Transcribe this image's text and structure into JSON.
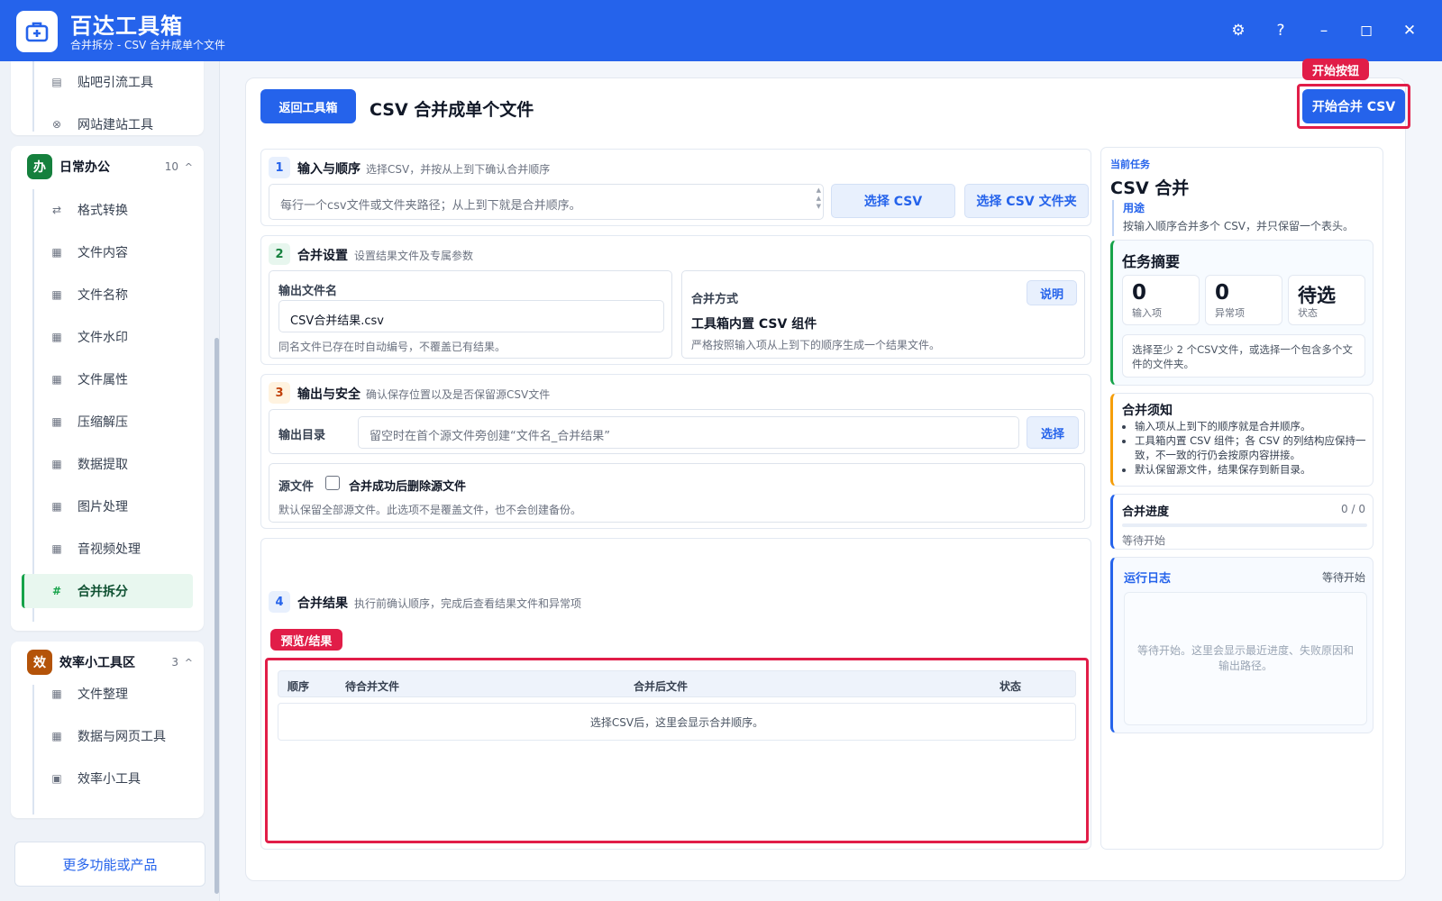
{
  "app": {
    "title": "百达工具箱",
    "subtitle": "合并拆分 - CSV 合并成单个文件"
  },
  "titlebar_icons": [
    "gear-icon",
    "help-icon",
    "minimize-icon",
    "maximize-icon",
    "close-icon"
  ],
  "sidebar": {
    "top_items": [
      {
        "label": "贴吧引流工具",
        "icon": "doc-icon"
      },
      {
        "label": "网站建站工具",
        "icon": "globe-icon"
      }
    ],
    "group_daily": {
      "badge": "办",
      "title": "日常办公",
      "count": "10",
      "color": "#15803d"
    },
    "daily_items": [
      {
        "label": "格式转换",
        "icon": "swap-icon"
      },
      {
        "label": "文件内容",
        "icon": "grid-icon"
      },
      {
        "label": "文件名称",
        "icon": "grid-icon"
      },
      {
        "label": "文件水印",
        "icon": "grid-icon"
      },
      {
        "label": "文件属性",
        "icon": "grid-icon"
      },
      {
        "label": "压缩解压",
        "icon": "grid-icon"
      },
      {
        "label": "数据提取",
        "icon": "grid-icon"
      },
      {
        "label": "图片处理",
        "icon": "grid-icon"
      },
      {
        "label": "音视频处理",
        "icon": "grid-icon"
      },
      {
        "label": "合并拆分",
        "icon": "hash-icon",
        "active": true
      }
    ],
    "group_eff": {
      "badge": "效",
      "title": "效率小工具区",
      "count": "3",
      "color": "#b45309"
    },
    "eff_items": [
      {
        "label": "文件整理",
        "icon": "grid-icon"
      },
      {
        "label": "数据与网页工具",
        "icon": "grid-icon"
      },
      {
        "label": "效率小工具",
        "icon": "box-icon"
      }
    ],
    "more_button": "更多功能或产品"
  },
  "header": {
    "back_button": "返回工具箱",
    "title": "CSV 合并成单个文件",
    "start_button": "开始合并 CSV",
    "start_tag": "开始按钮"
  },
  "section1": {
    "num": "1",
    "title": "输入与顺序",
    "desc": "选择CSV，并按从上到下确认合并顺序",
    "placeholder": "每行一个csv文件或文件夹路径；从上到下就是合并顺序。",
    "btn_select": "选择 CSV",
    "btn_select_folder": "选择 CSV 文件夹"
  },
  "section2": {
    "num": "2",
    "title": "合并设置",
    "desc": "设置结果文件及专属参数",
    "out_label": "输出文件名",
    "out_value": "CSV合并结果.csv",
    "out_hint": "同名文件已存在时自动编号，不覆盖已有结果。",
    "mode_label": "合并方式",
    "mode_help": "说明",
    "mode_value": "工具箱内置 CSV 组件",
    "mode_hint": "严格按照输入项从上到下的顺序生成一个结果文件。"
  },
  "section3": {
    "num": "3",
    "title": "输出与安全",
    "desc": "确认保存位置以及是否保留源CSV文件",
    "dir_label": "输出目录",
    "dir_placeholder": "留空时在首个源文件旁创建“文件名_合并结果”",
    "dir_button": "选择",
    "src_label": "源文件",
    "delete_label": "合并成功后删除源文件",
    "delete_checked": false,
    "src_hint": "默认保留全部源文件。此选项不是覆盖文件，也不会创建备份。"
  },
  "section4": {
    "num": "4",
    "title": "合并结果",
    "desc": "执行前确认顺序，完成后查看结果文件和异常项",
    "tag": "预览/结果",
    "columns": [
      "顺序",
      "待合并文件",
      "合并后文件",
      "状态"
    ],
    "empty": "选择CSV后，这里会显示合并顺序。"
  },
  "right": {
    "eyebrow": "当前任务",
    "title": "CSV 合并",
    "use_label": "用途",
    "use_text": "按输入顺序合并多个 CSV，并只保留一个表头。",
    "summary_title": "任务摘要",
    "stats": [
      {
        "value": "0",
        "label": "输入项"
      },
      {
        "value": "0",
        "label": "异常项"
      },
      {
        "value": "待选",
        "label": "状态"
      }
    ],
    "summary_note": "选择至少 2 个CSV文件，或选择一个包含多个文件的文件夹。",
    "notes_title": "合并须知",
    "notes": [
      "输入项从上到下的顺序就是合并顺序。",
      "工具箱内置 CSV 组件；各 CSV 的列结构应保持一致，不一致的行仍会按原内容拼接。",
      "默认保留源文件，结果保存到新目录。"
    ],
    "progress_title": "合并进度",
    "progress_count": "0 / 0",
    "progress_fraction": 0,
    "progress_status": "等待开始",
    "log_title": "运行日志",
    "log_status": "等待开始",
    "log_empty": "等待开始。这里会显示最近进度、失败原因和输出路径。"
  }
}
